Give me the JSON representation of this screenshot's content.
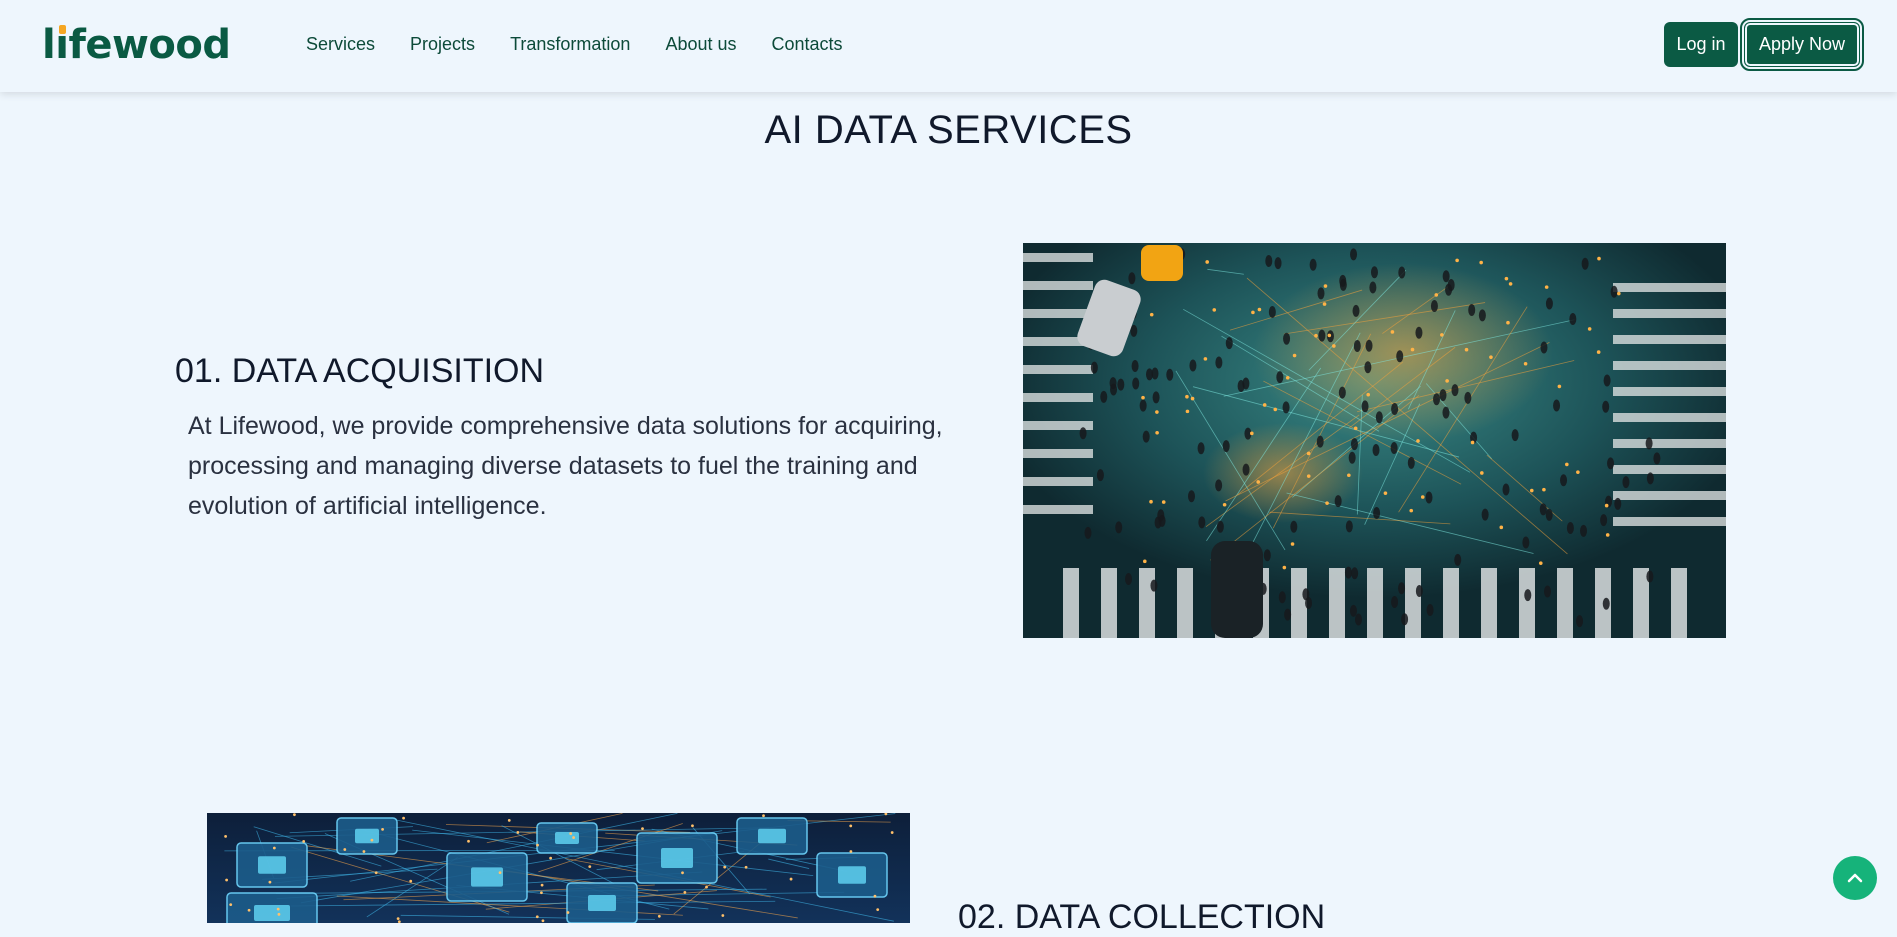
{
  "header": {
    "logo_text_before": "l",
    "logo_text_i": "ı",
    "logo_text_after": "fewood",
    "nav": [
      {
        "label": "Services"
      },
      {
        "label": "Projects"
      },
      {
        "label": "Transformation"
      },
      {
        "label": "About us"
      },
      {
        "label": "Contacts"
      }
    ],
    "login_label": "Log in",
    "apply_label": "Apply Now"
  },
  "main": {
    "title": "AI DATA SERVICES",
    "sections": [
      {
        "heading": "01. DATA ACQUISITION",
        "text": "At Lifewood, we provide comprehensive data solutions for acquiring, processing and managing diverse datasets to fuel the training and evolution of artificial intelligence."
      },
      {
        "heading": "02. DATA COLLECTION"
      }
    ]
  },
  "icons": {
    "logo_dot": "orange-dot",
    "scroll_top": "chevron-up-icon"
  },
  "colors": {
    "brand": "#0b5a44",
    "accent": "#f5a623",
    "background": "#eef6fd",
    "scroll_button": "#16b37a"
  }
}
